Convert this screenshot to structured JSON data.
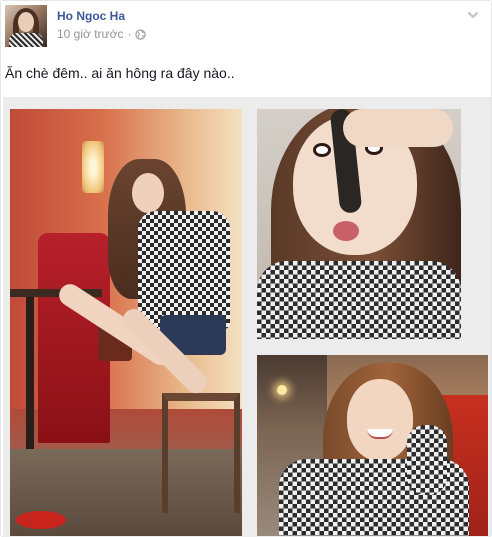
{
  "post": {
    "author": "Ho Ngoc Ha",
    "timestamp": "10 giờ trước",
    "separator": "·",
    "privacy_icon": "globe-icon",
    "menu_icon": "chevron-down-icon",
    "text": "Ăn chè đêm.. ai ăn hông ra đây nào..",
    "link_color": "#3b5998"
  },
  "photos": [
    {
      "id": "photo-1",
      "subject": "woman-sitting-in-cafe"
    },
    {
      "id": "photo-2",
      "subject": "selfie-with-spoon"
    },
    {
      "id": "photo-3",
      "subject": "smiling-selfie"
    }
  ]
}
